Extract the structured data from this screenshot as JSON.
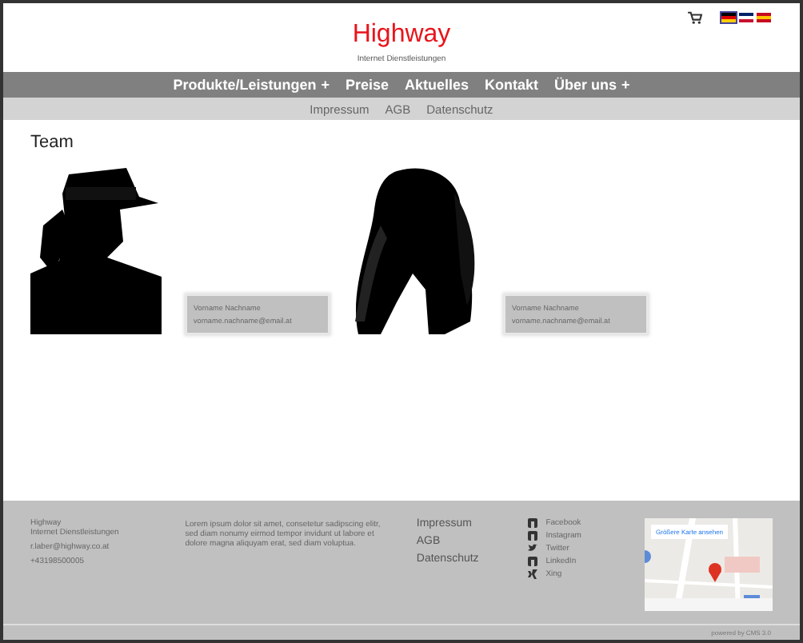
{
  "header": {
    "title": "Highway",
    "subtitle": "Internet Dienstleistungen",
    "flags": [
      {
        "kind": "de",
        "selected": true
      },
      {
        "kind": "gb",
        "selected": false
      },
      {
        "kind": "es",
        "selected": false
      }
    ]
  },
  "nav": [
    {
      "label": "Produkte/Leistungen",
      "expandable": true
    },
    {
      "label": "Preise",
      "expandable": false
    },
    {
      "label": "Aktuelles",
      "expandable": false
    },
    {
      "label": "Kontakt",
      "expandable": false
    },
    {
      "label": "Über uns",
      "expandable": true
    }
  ],
  "plus": "+",
  "subnav": [
    "Impressum",
    "AGB",
    "Datenschutz"
  ],
  "team": {
    "heading": "Team",
    "members": [
      {
        "kind": "picture",
        "name": "Vorname Nachname",
        "email": "vorname.nachname@email.at"
      },
      {
        "kind": "picture",
        "name": "Vorname Nachname",
        "email": "vorname.nachname@email.at"
      }
    ]
  },
  "footer": {
    "contact": [
      "Highway",
      "Internet Dienstleistungen",
      "r.laber@highway.co.at",
      "+43198500005"
    ],
    "text": "Lorem ipsum dolor sit amet, consetetur sadipscing elitr, sed diam nonumy eirmod tempor invidunt ut labore et dolore magna aliquyam erat, sed diam voluptua.",
    "links": [
      "Impressum",
      "AGB",
      "Datenschutz"
    ],
    "social": [
      {
        "kind": "facebook",
        "label": "Facebook"
      },
      {
        "kind": "instagram",
        "label": "Instagram"
      },
      {
        "kind": "twitter",
        "label": "Twitter"
      },
      {
        "kind": "linkedin",
        "label": "LinkedIn"
      },
      {
        "kind": "xing",
        "label": "Xing"
      }
    ],
    "map": {
      "kind": "picture",
      "button": "Größere Karte ansehen"
    },
    "powered": "powered by CMS 3.0"
  }
}
